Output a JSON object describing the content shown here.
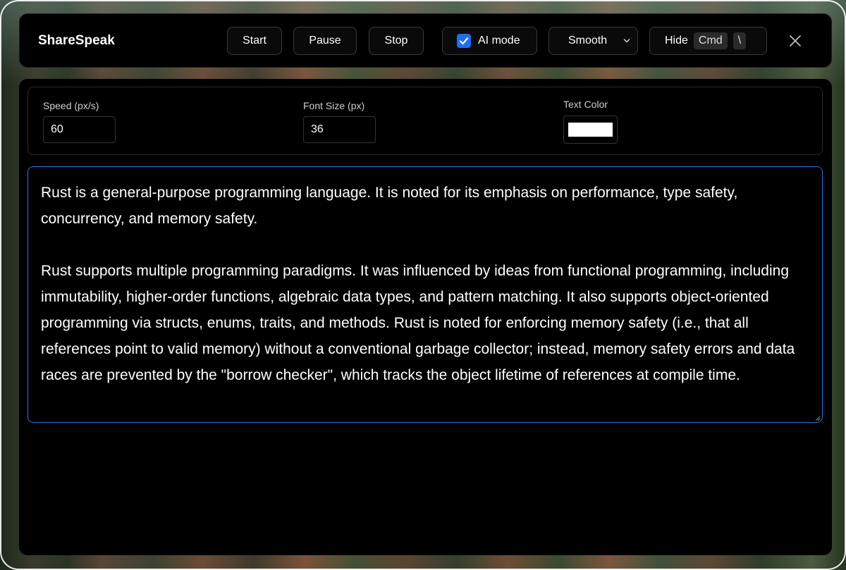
{
  "app": {
    "title": "ShareSpeak"
  },
  "toolbar": {
    "start_label": "Start",
    "pause_label": "Pause",
    "stop_label": "Stop",
    "ai_mode_label": "AI mode",
    "ai_mode_checked": true,
    "scroll_mode_value": "Smooth",
    "hide_label": "Hide",
    "hide_shortcut_key1": "Cmd",
    "hide_shortcut_key2": "\\",
    "close_icon": "close-icon"
  },
  "settings": {
    "speed_label": "Speed (px/s)",
    "speed_value": "60",
    "font_size_label": "Font Size (px)",
    "font_size_value": "36",
    "text_color_label": "Text Color",
    "text_color_value": "#ffffff"
  },
  "script": {
    "text": "Rust is a general-purpose programming language. It is noted for its emphasis on performance, type safety, concurrency, and memory safety.\n\nRust supports multiple programming paradigms. It was influenced by ideas from functional programming, including immutability, higher-order functions, algebraic data types, and pattern matching. It also supports object-oriented programming via structs, enums, traits, and methods. Rust is noted for enforcing memory safety (i.e., that all references point to valid memory) without a conventional garbage collector; instead, memory safety errors and data races are prevented by the \"borrow checker\", which tracks the object lifetime of references at compile time."
  },
  "colors": {
    "accent": "#1f6feb",
    "focus_border": "#2f6fe0",
    "panel_bg": "#000000"
  }
}
